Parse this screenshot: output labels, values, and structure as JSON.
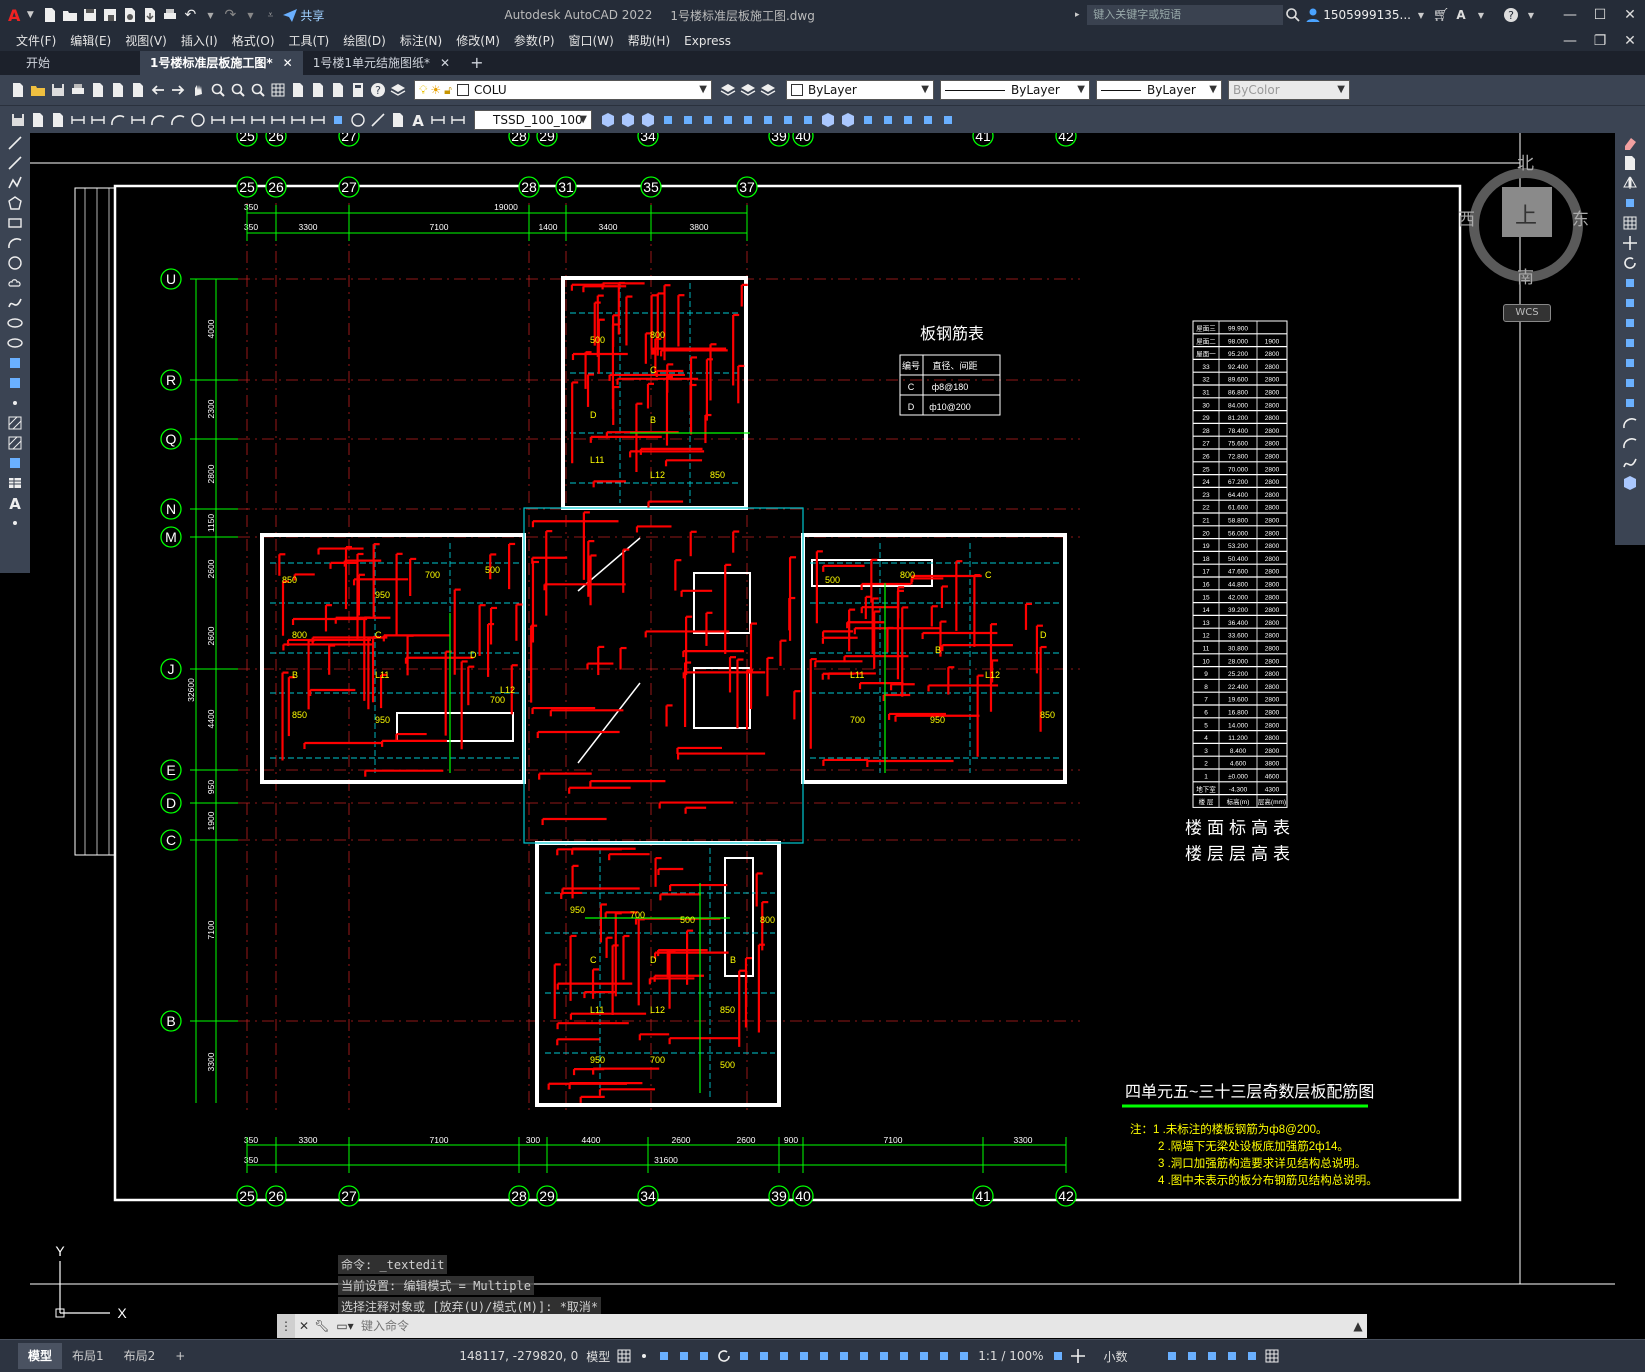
{
  "app": {
    "title": "Autodesk AutoCAD 2022",
    "doc_title": "1号楼标准层板施工图.dwg",
    "share_label": "共享",
    "search_placeholder": "键入关键字或短语",
    "user": "1505999135...",
    "logo_letter": "A"
  },
  "menu": [
    "文件(F)",
    "编辑(E)",
    "视图(V)",
    "插入(I)",
    "格式(O)",
    "工具(T)",
    "绘图(D)",
    "标注(N)",
    "修改(M)",
    "参数(P)",
    "窗口(W)",
    "帮助(H)",
    "Express"
  ],
  "doc_tabs": [
    "开始",
    "1号楼标准层板施工图*",
    "1号楼1单元结施图纸*"
  ],
  "layer_toolbar": {
    "layer": "COLU",
    "color": "ByLayer",
    "linetype": "ByLayer",
    "lineweight": "ByLayer",
    "plotstyle": "ByColor",
    "textstyle": "TSSD_100_100"
  },
  "viewcube": {
    "north": "北",
    "south": "南",
    "east": "东",
    "west": "西",
    "top": "上",
    "wcs": "WCS"
  },
  "drawing": {
    "top_axes_outer": [
      "25",
      "26",
      "27",
      "28",
      "29",
      "34",
      "39",
      "40",
      "41",
      "42"
    ],
    "top_axes_inner": [
      "25",
      "26",
      "27",
      "28",
      "31",
      "35",
      "37"
    ],
    "bottom_axes": [
      "25",
      "26",
      "27",
      "28",
      "29",
      "34",
      "39",
      "40",
      "41",
      "42"
    ],
    "left_axes": [
      "U",
      "R",
      "Q",
      "N",
      "M",
      "J",
      "E",
      "D",
      "C",
      "B"
    ],
    "top_dims_total": "19000",
    "top_dims": [
      "350",
      "3300",
      "7100",
      "1400",
      "3400",
      "3800"
    ],
    "top_dim_small": "350",
    "left_dims": [
      "4000",
      "2300",
      "2800",
      "1150",
      "2600",
      "2600",
      "4400",
      "950",
      "1900",
      "7100",
      "3300"
    ],
    "left_total": "32600",
    "bottom_dims": [
      "350",
      "3300",
      "7100",
      "300",
      "4400",
      "2600",
      "2600",
      "900",
      "7100",
      "3300"
    ],
    "bottom_dim_small": "350",
    "bottom_total": "31600",
    "plan_labels": [
      "850",
      "950",
      "700",
      "500",
      "800",
      "C",
      "D",
      "B",
      "L11",
      "L12"
    ],
    "rebar_table": {
      "title": "板钢筋表",
      "headers": [
        "编号",
        "直径、间距"
      ],
      "rows": [
        [
          "C",
          "ф8@180"
        ],
        [
          "D",
          "ф10@200"
        ]
      ]
    },
    "elevation_table": {
      "rows": [
        [
          "屋面三",
          "99.900",
          ""
        ],
        [
          "屋面二",
          "98.000",
          "1900"
        ],
        [
          "屋面一",
          "95.200",
          "2800"
        ],
        [
          "33",
          "92.400",
          "2800"
        ],
        [
          "32",
          "89.600",
          "2800"
        ],
        [
          "31",
          "86.800",
          "2800"
        ],
        [
          "30",
          "84.000",
          "2800"
        ],
        [
          "29",
          "81.200",
          "2800"
        ],
        [
          "28",
          "78.400",
          "2800"
        ],
        [
          "27",
          "75.600",
          "2800"
        ],
        [
          "26",
          "72.800",
          "2800"
        ],
        [
          "25",
          "70.000",
          "2800"
        ],
        [
          "24",
          "67.200",
          "2800"
        ],
        [
          "23",
          "64.400",
          "2800"
        ],
        [
          "22",
          "61.600",
          "2800"
        ],
        [
          "21",
          "58.800",
          "2800"
        ],
        [
          "20",
          "56.000",
          "2800"
        ],
        [
          "19",
          "53.200",
          "2800"
        ],
        [
          "18",
          "50.400",
          "2800"
        ],
        [
          "17",
          "47.600",
          "2800"
        ],
        [
          "16",
          "44.800",
          "2800"
        ],
        [
          "15",
          "42.000",
          "2800"
        ],
        [
          "14",
          "39.200",
          "2800"
        ],
        [
          "13",
          "36.400",
          "2800"
        ],
        [
          "12",
          "33.600",
          "2800"
        ],
        [
          "11",
          "30.800",
          "2800"
        ],
        [
          "10",
          "28.000",
          "2800"
        ],
        [
          "9",
          "25.200",
          "2800"
        ],
        [
          "8",
          "22.400",
          "2800"
        ],
        [
          "7",
          "19.600",
          "2800"
        ],
        [
          "6",
          "16.800",
          "2800"
        ],
        [
          "5",
          "14.000",
          "2800"
        ],
        [
          "4",
          "11.200",
          "2800"
        ],
        [
          "3",
          "8.400",
          "2800"
        ],
        [
          "2",
          "4.600",
          "3800"
        ],
        [
          "1",
          "±0.000",
          "4600"
        ],
        [
          "地下室",
          "-4.300",
          "4300"
        ],
        [
          "楼 层",
          "标高(m)",
          "层高(mm)"
        ]
      ],
      "caption1": "楼面标高表",
      "caption2": "楼层层高表"
    },
    "drawing_title": "四单元五~三十三层奇数层板配筋图",
    "notes": [
      "注：1  .未标注的楼板钢筋为ф8@200。",
      "2  .隔墙下无梁处设板底加强筋2ф14。",
      "3  .洞口加强筋构造要求详见结构总说明。",
      "4  .图中未表示的板分布钢筋见结构总说明。"
    ],
    "ucs_x": "X",
    "ucs_y": "Y"
  },
  "command": {
    "history": [
      "命令: _textedit",
      "当前设置: 编辑模式 = Multiple",
      "选择注释对象或 [放弃(U)/模式(M)]: *取消*"
    ],
    "placeholder": "键入命令"
  },
  "status": {
    "layout_tabs": [
      "模型",
      "布局1",
      "布局2"
    ],
    "coords": "148117, -279820, 0",
    "model": "模型",
    "scale": "1:1 / 100%",
    "units": "小数"
  },
  "colors": {
    "accent": "#d02020",
    "green": "#00ff00",
    "red": "#ff0000",
    "cyan": "#00c8d0",
    "yellow": "#ffff00",
    "white": "#ffffff"
  }
}
